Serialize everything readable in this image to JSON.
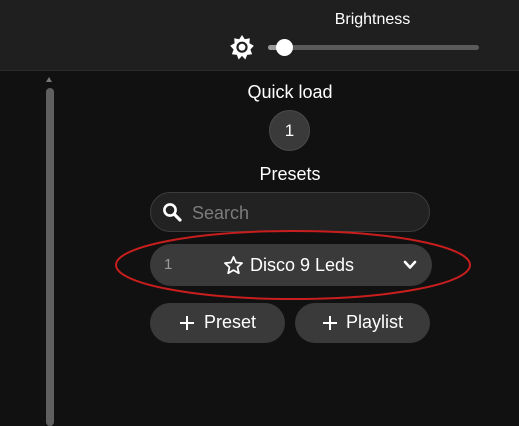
{
  "header": {
    "brightness_label": "Brightness",
    "brightness_icon": "sun-icon",
    "brightness_fraction": 0.08
  },
  "quick_load": {
    "title": "Quick load",
    "buttons": [
      "1"
    ]
  },
  "presets": {
    "title": "Presets",
    "search_placeholder": "Search",
    "search_icon": "search-icon",
    "items": [
      {
        "id": "1",
        "icon": "star-icon",
        "name": "Disco 9 Leds",
        "expand_icon": "chevron-down-icon"
      }
    ]
  },
  "actions": {
    "add_preset": "Preset",
    "add_playlist": "Playlist",
    "icon": "plus-icon"
  },
  "colors": {
    "background": "#111111",
    "header": "#1f1f1f",
    "button": "#3a3a3a",
    "highlight": "#c81e1e"
  }
}
